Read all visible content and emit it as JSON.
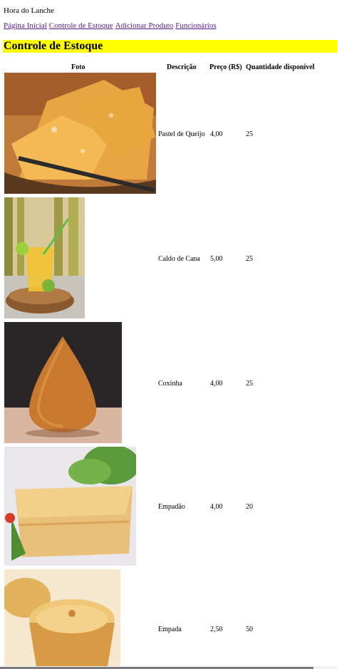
{
  "site": {
    "title": "Hora do Lanche"
  },
  "nav": [
    {
      "label": "Página Inicial"
    },
    {
      "label": "Controle de Estoque"
    },
    {
      "label": "Adicionar Produto"
    },
    {
      "label": "Funcionários"
    }
  ],
  "page": {
    "heading": "Controle de Estoque"
  },
  "table": {
    "headers": {
      "foto": "Foto",
      "descricao": "Descrição",
      "preco": "Preço (R$)",
      "quantidade": "Quantidade disponível"
    },
    "rows": [
      {
        "descricao": "Pastel de Queijo",
        "preco": "4,00",
        "quantidade": "25"
      },
      {
        "descricao": "Caldo de Cana",
        "preco": "5,00",
        "quantidade": "25"
      },
      {
        "descricao": "Coxinha",
        "preco": "4,00",
        "quantidade": "25"
      },
      {
        "descricao": "Empadão",
        "preco": "4,00",
        "quantidade": "20"
      },
      {
        "descricao": "Empada",
        "preco": "2,50",
        "quantidade": "50"
      }
    ]
  }
}
